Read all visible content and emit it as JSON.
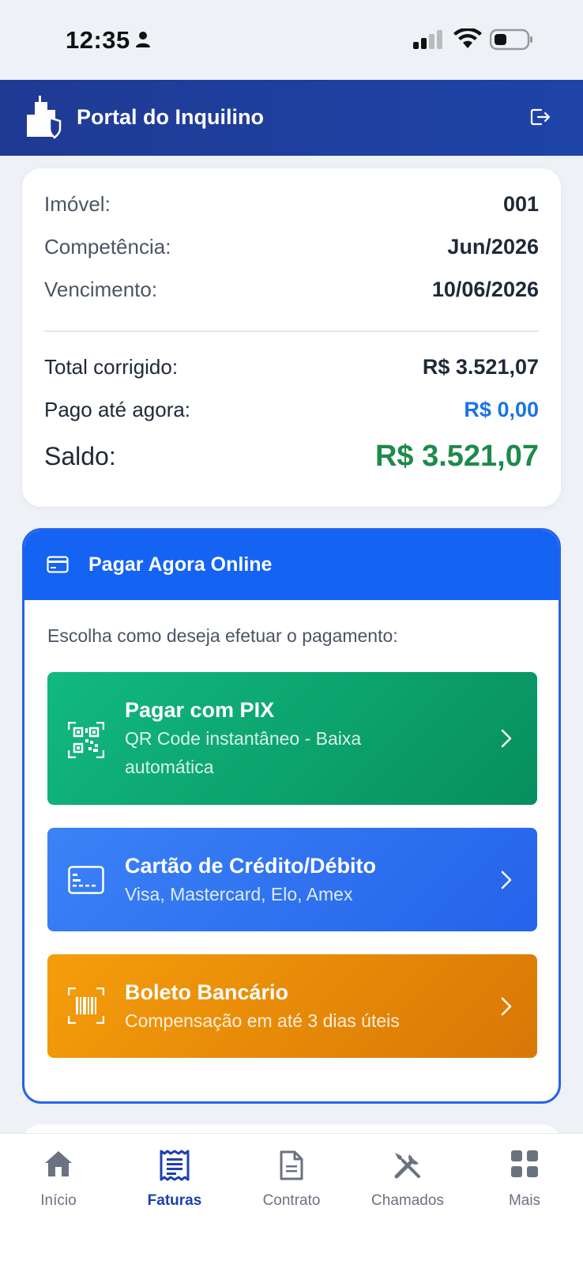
{
  "status": {
    "time": "12:35"
  },
  "header": {
    "title": "Portal do Inquilino"
  },
  "summary": {
    "imovel_label": "Imóvel:",
    "imovel_value": "001",
    "competencia_label": "Competência:",
    "competencia_value": "Jun/2026",
    "vencimento_label": "Vencimento:",
    "vencimento_value": "10/06/2026",
    "total_label": "Total corrigido:",
    "total_value": "R$ 3.521,07",
    "pago_label": "Pago até agora:",
    "pago_value": "R$ 0,00",
    "saldo_label": "Saldo:",
    "saldo_value": "R$ 3.521,07"
  },
  "payment": {
    "title": "Pagar Agora Online",
    "instructions": "Escolha como deseja efetuar o pagamento:",
    "options": [
      {
        "title": "Pagar com PIX",
        "subtitle": "QR Code instantâneo - Baixa automática",
        "icon": "qr-code-icon"
      },
      {
        "title": "Cartão de Crédito/Débito",
        "subtitle": "Visa, Mastercard, Elo, Amex",
        "icon": "credit-card-icon"
      },
      {
        "title": "Boleto Bancário",
        "subtitle": "Compensação em até 3 dias úteis",
        "icon": "barcode-icon"
      }
    ]
  },
  "nav": [
    {
      "label": "Início",
      "icon": "home-icon"
    },
    {
      "label": "Faturas",
      "icon": "invoice-icon",
      "active": true
    },
    {
      "label": "Contrato",
      "icon": "document-icon"
    },
    {
      "label": "Chamados",
      "icon": "tools-icon"
    },
    {
      "label": "Mais",
      "icon": "grid-icon"
    }
  ],
  "colors": {
    "header": "#1f3a93",
    "primary": "#1463f3",
    "pix": "#10b981",
    "card": "#3b82f6",
    "boleto": "#f59e0b",
    "saldo": "#1f8a4c",
    "pago": "#1a73e8"
  }
}
